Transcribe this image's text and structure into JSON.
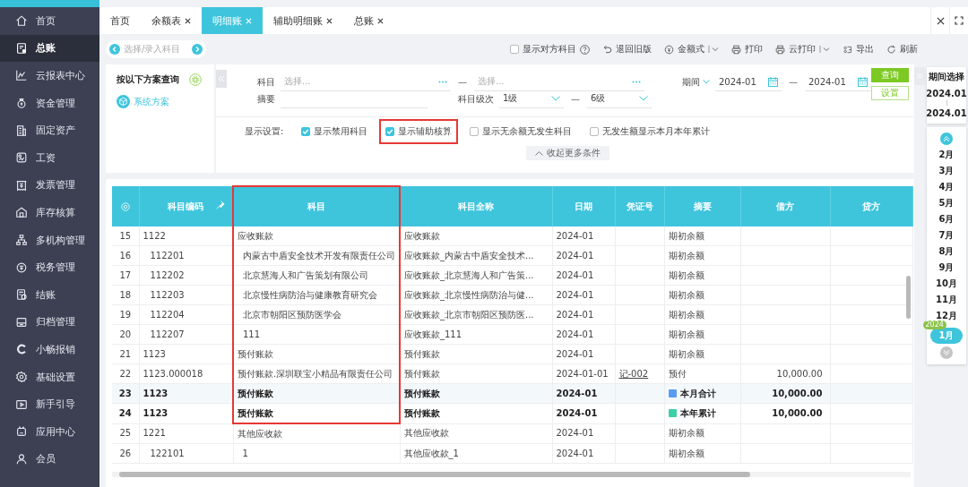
{
  "sidebar": {
    "items": [
      {
        "label": "首页",
        "selected": false
      },
      {
        "label": "总账",
        "selected": true
      },
      {
        "label": "云报表中心",
        "selected": false
      },
      {
        "label": "资金管理",
        "selected": false
      },
      {
        "label": "固定资产",
        "selected": false
      },
      {
        "label": "工资",
        "selected": false
      },
      {
        "label": "发票管理",
        "selected": false
      },
      {
        "label": "库存核算",
        "selected": false
      },
      {
        "label": "多机构管理",
        "selected": false
      },
      {
        "label": "税务管理",
        "selected": false
      },
      {
        "label": "结账",
        "selected": false
      },
      {
        "label": "归档管理",
        "selected": false
      },
      {
        "label": "小畅报销",
        "selected": false
      },
      {
        "label": "基础设置",
        "selected": false
      },
      {
        "label": "新手引导",
        "selected": false
      },
      {
        "label": "应用中心",
        "selected": false
      },
      {
        "label": "会员",
        "selected": false
      }
    ]
  },
  "tabs": [
    {
      "label": "首页",
      "closable": false,
      "selected": false
    },
    {
      "label": "余额表",
      "closable": true,
      "selected": false
    },
    {
      "label": "明细账",
      "closable": true,
      "selected": true
    },
    {
      "label": "辅助明细账",
      "closable": true,
      "selected": false
    },
    {
      "label": "总账",
      "closable": true,
      "selected": false
    }
  ],
  "toolbar": {
    "subject_nav": {
      "placeholder": "选择/录入科目"
    },
    "show_counter_subject": {
      "label": "显示对方科目",
      "checked": false
    },
    "actions": [
      {
        "label": "退回旧版",
        "dropdown": false
      },
      {
        "label": "金额式",
        "dropdown": true
      },
      {
        "label": "打印",
        "dropdown": false
      },
      {
        "label": "云打印",
        "dropdown": true
      },
      {
        "label": "导出",
        "dropdown": false
      },
      {
        "label": "刷新",
        "dropdown": false
      }
    ]
  },
  "scheme_panel": {
    "title": "按以下方案查询",
    "items": [
      {
        "label": "系统方案"
      }
    ]
  },
  "filters": {
    "subject_label": "科目",
    "subject_from": {
      "placeholder": "选择..."
    },
    "subject_separator": "—",
    "subject_to": {
      "placeholder": "选择..."
    },
    "period_label": "期间",
    "period_from": "2024-01",
    "period_separator": "—",
    "period_to": "2024-01",
    "summary_label": "摘要",
    "level_label": "科目级次",
    "level_from": "1级",
    "level_separator": "—",
    "level_to": "6级",
    "query_button": "查询",
    "settings_button": "设置",
    "display_label": "显示设置:",
    "options": [
      {
        "label": "显示禁用科目",
        "checked": true,
        "highlighted": false
      },
      {
        "label": "显示辅助核算",
        "checked": true,
        "highlighted": true
      },
      {
        "label": "显示无余额无发生科目",
        "checked": false,
        "highlighted": false
      },
      {
        "label": "无发生额显示本月本年累计",
        "checked": false,
        "highlighted": false
      }
    ],
    "collapse_label": "收起更多条件"
  },
  "table": {
    "columns": [
      {
        "label": "科目编码",
        "highlighted": false
      },
      {
        "label": "科目",
        "highlighted": true
      },
      {
        "label": "科目全称",
        "highlighted": false
      },
      {
        "label": "日期",
        "highlighted": false
      },
      {
        "label": "凭证号",
        "highlighted": false
      },
      {
        "label": "摘要",
        "highlighted": false
      },
      {
        "label": "借方",
        "highlighted": false
      },
      {
        "label": "贷方",
        "highlighted": false
      }
    ],
    "rows": [
      {
        "no": "15",
        "code": "1122",
        "subject": "应收账款",
        "full_name": "应收账款",
        "date": "2024-01",
        "summary": "期初余额",
        "kind": "detail",
        "selected": false,
        "framed": true,
        "children": [
          {
            "no": "16",
            "code": "112201",
            "subject": "内蒙古中盾安全技术开发有限责任公司",
            "full_name": "应收账款_内蒙古中盾安全技术...",
            "date": "2024-01",
            "summary": "期初余额",
            "kind": "detail",
            "selected": false,
            "framed": true
          },
          {
            "no": "17",
            "code": "112202",
            "subject": "北京慧海人和广告策划有限公司",
            "full_name": "应收账款_北京慧海人和广告策...",
            "date": "2024-01",
            "summary": "期初余额",
            "kind": "detail",
            "selected": false,
            "framed": true
          },
          {
            "no": "18",
            "code": "112203",
            "subject": "北京慢性病防治与健康教育研究会",
            "full_name": "应收账款_北京慢性病防治与健...",
            "date": "2024-01",
            "summary": "期初余额",
            "kind": "detail",
            "selected": false,
            "framed": true
          },
          {
            "no": "19",
            "code": "112204",
            "subject": "北京市朝阳区预防医学会",
            "full_name": "应收账款_北京市朝阳区预防医...",
            "date": "2024-01",
            "summary": "期初余额",
            "kind": "detail",
            "selected": false,
            "framed": true
          },
          {
            "no": "20",
            "code": "112207",
            "subject": "111",
            "full_name": "应收账款_111",
            "date": "2024-01",
            "summary": "期初余额",
            "kind": "detail",
            "selected": false,
            "framed": true
          }
        ]
      },
      {
        "no": "21",
        "code": "1123",
        "subject": "预付账款",
        "full_name": "预付账款",
        "date": "2024-01",
        "summary": "期初余额",
        "kind": "detail",
        "selected": false,
        "framed": true
      },
      {
        "no": "22",
        "code": "1123.000018",
        "subject": "预付账款.深圳联宝小精品有限责任公司",
        "full_name": "预付账款",
        "date": "2024-01-01",
        "voucher": "记-002",
        "summary": "预付",
        "debit": "10,000.00",
        "kind": "detail",
        "selected": false,
        "framed": true
      },
      {
        "no": "23",
        "code": "1123",
        "subject": "预付账款",
        "full_name": "预付账款",
        "date": "2024-01",
        "summary": "本月合计",
        "debit": "10,000.00",
        "kind": "total",
        "color": "#5b9cf0",
        "selected": true,
        "framed": true
      },
      {
        "no": "24",
        "code": "1123",
        "subject": "预付账款",
        "full_name": "预付账款",
        "date": "2024-01",
        "summary": "本年累计",
        "debit": "10,000.00",
        "kind": "total",
        "color": "#3ecfa8",
        "selected": false,
        "framed": true
      },
      {
        "no": "25",
        "code": "1221",
        "subject": "其他应收款",
        "full_name": "其他应收款",
        "date": "2024-01",
        "summary": "期初余额",
        "kind": "detail",
        "selected": false,
        "framed": false,
        "children": [
          {
            "no": "26",
            "code": "122101",
            "subject": "1",
            "full_name": "其他应收款_1",
            "date": "2024-01",
            "summary": "期初余额",
            "kind": "detail",
            "selected": false,
            "framed": false
          }
        ]
      }
    ]
  },
  "period_panel": {
    "title": "期间选择",
    "from": "2024.01",
    "to": "2024.01",
    "months": [
      {
        "label": "2月",
        "selected": false
      },
      {
        "label": "3月",
        "selected": false
      },
      {
        "label": "4月",
        "selected": false
      },
      {
        "label": "5月",
        "selected": false
      },
      {
        "label": "6月",
        "selected": false
      },
      {
        "label": "7月",
        "selected": false
      },
      {
        "label": "8月",
        "selected": false
      },
      {
        "label": "9月",
        "selected": false
      },
      {
        "label": "10月",
        "selected": false
      },
      {
        "label": "11月",
        "selected": false
      },
      {
        "label": "12月",
        "selected": false
      },
      {
        "label": "1月",
        "selected": true,
        "year_badge": "2024"
      }
    ]
  }
}
